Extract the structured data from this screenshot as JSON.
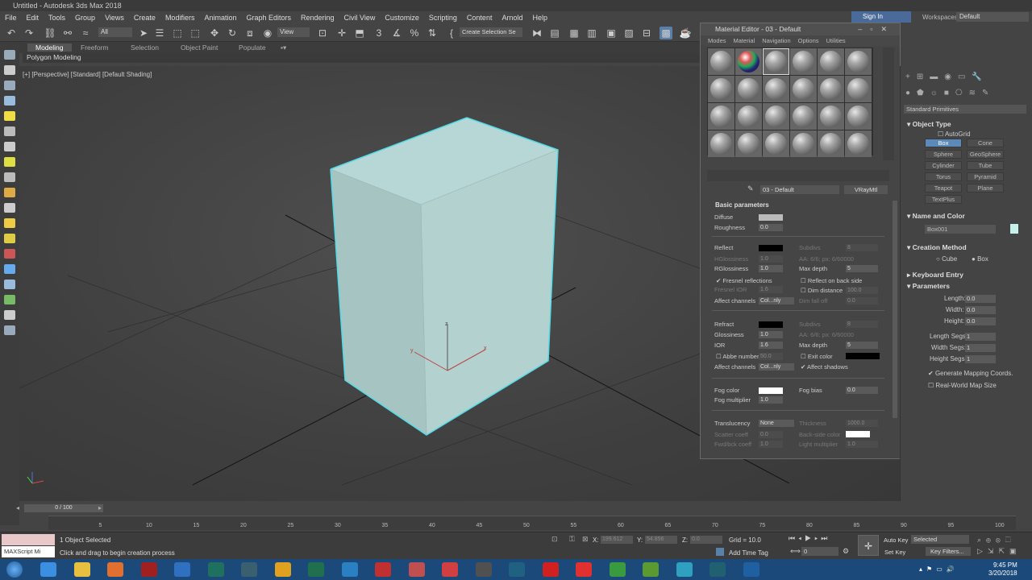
{
  "app": {
    "title": "Untitled - Autodesk 3ds Max 2018",
    "signin": "Sign In",
    "workspaces_label": "Workspaces:",
    "workspace": "Default"
  },
  "menu": [
    "File",
    "Edit",
    "Tools",
    "Group",
    "Views",
    "Create",
    "Modifiers",
    "Animation",
    "Graph Editors",
    "Rendering",
    "Civil View",
    "Customize",
    "Scripting",
    "Content",
    "Arnold",
    "Help"
  ],
  "toolbar": {
    "filter": "All",
    "view": "View",
    "selection_set": "Create Selection Se"
  },
  "ribbon": {
    "tabs": [
      "Modeling",
      "Freeform",
      "Selection",
      "Object Paint",
      "Populate"
    ],
    "sub": "Polygon Modeling"
  },
  "viewport": {
    "label": "[+] [Perspective] [Standard] [Default Shading]"
  },
  "material_editor": {
    "title": "Material Editor - 03 - Default",
    "menu": [
      "Modes",
      "Material",
      "Navigation",
      "Options",
      "Utilities"
    ],
    "material_name": "03 - Default",
    "material_type": "VRayMtl",
    "section": "Basic parameters",
    "diffuse": "Diffuse",
    "roughness": "Roughness",
    "roughness_val": "0.0",
    "reflect": "Reflect",
    "hglossiness": "HGlossiness",
    "hgloss_val": "1.0",
    "rglossiness": "RGlossiness",
    "rgloss_val": "1.0",
    "subdivs": "Subdivs",
    "subdivs_val": "8",
    "aa": "AA: 6/6; px: 6/60000",
    "max_depth": "Max depth",
    "max_depth_val": "5",
    "fresnel": "Fresnel reflections",
    "reflect_back": "Reflect on back side",
    "fresnel_ior": "Fresnel IOR",
    "fresnel_ior_val": "1.6",
    "dim_distance": "Dim distance",
    "dim_distance_val": "100.0",
    "affect_channels": "Affect channels",
    "affect_val": "Col...nly",
    "dim_falloff": "Dim fall off",
    "dim_falloff_val": "0.0",
    "refract": "Refract",
    "glossiness": "Glossiness",
    "gloss_val": "1.0",
    "ior": "IOR",
    "ior_val": "1.6",
    "abbe": "Abbe number",
    "abbe_val": "50.0",
    "exit_color": "Exit color",
    "affect_shadows": "Affect shadows",
    "fog_color": "Fog color",
    "fog_bias": "Fog bias",
    "fog_bias_val": "0.0",
    "fog_mult": "Fog multiplier",
    "fog_mult_val": "1.0",
    "translucency": "Translucency",
    "transl_val": "None",
    "thickness": "Thickness",
    "thickness_val": "1000.0",
    "scatter": "Scatter coeff",
    "scatter_val": "0.0",
    "backside": "Back-side color",
    "fwd": "Fwd/bck coeff",
    "fwd_val": "1.0",
    "light_mult": "Light multiplier",
    "light_mult_val": "1.0"
  },
  "command_panel": {
    "dropdown": "Standard Primitives",
    "object_type": "Object Type",
    "autogrid": "AutoGrid",
    "buttons": [
      "Box",
      "Cone",
      "Sphere",
      "GeoSphere",
      "Cylinder",
      "Tube",
      "Torus",
      "Pyramid",
      "Teapot",
      "Plane",
      "TextPlus"
    ],
    "name_color": "Name and Color",
    "object_name": "Box001",
    "creation_method": "Creation Method",
    "cube": "Cube",
    "box": "Box",
    "keyboard_entry": "Keyboard Entry",
    "parameters": "Parameters",
    "length": "Length:",
    "width": "Width:",
    "height": "Height:",
    "length_val": "0.0",
    "width_val": "0.0",
    "height_val": "0.0",
    "length_segs": "Length Segs:",
    "width_segs": "Width Segs:",
    "height_segs": "Height Segs:",
    "segs_val": "1",
    "gen_map": "Generate Mapping Coords.",
    "real_world": "Real-World Map Size"
  },
  "timeline": {
    "frame": "0 / 100",
    "ticks": [
      "5",
      "10",
      "15",
      "20",
      "25",
      "30",
      "35",
      "40",
      "45",
      "50",
      "55",
      "60",
      "65",
      "70",
      "75",
      "80",
      "85",
      "90",
      "95",
      "100"
    ]
  },
  "status": {
    "script": "MAXScript Mi",
    "selected": "1 Object Selected",
    "prompt": "Click and drag to begin creation process",
    "x_label": "X:",
    "x_val": "199.612",
    "y_label": "Y:",
    "y_val": "54.856",
    "z_label": "Z:",
    "z_val": "0.0",
    "grid": "Grid = 10.0",
    "add_time_tag": "Add Time Tag",
    "auto_key": "Auto Key",
    "selected_dd": "Selected",
    "set_key": "Set Key",
    "key_filters": "Key Filters...",
    "frame_val": "0"
  },
  "clock": {
    "time": "9:45 PM",
    "date": "3/20/2018"
  },
  "colors": {
    "box_face": "#b5d3d2",
    "box_side": "#a3c0bf",
    "box_outline": "#4dd7e6",
    "taskbar": "#1b4a7a"
  }
}
